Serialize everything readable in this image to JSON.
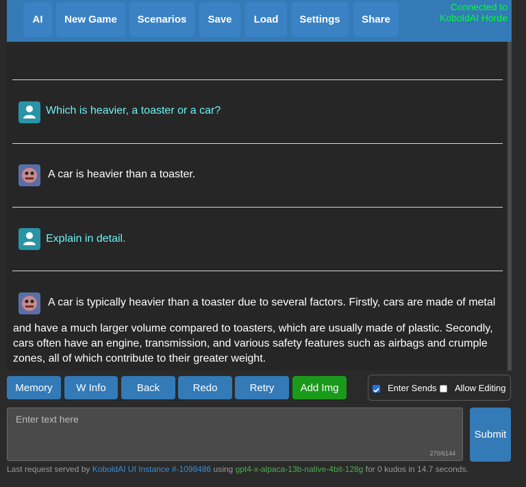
{
  "nav": {
    "buttons": [
      "AI",
      "New Game",
      "Scenarios",
      "Save",
      "Load",
      "Settings",
      "Share"
    ],
    "status_line1": "Connected to",
    "status_line2": "KoboldAI Horde"
  },
  "chat": {
    "messages": [
      {
        "role": "user",
        "text": "Which is heavier, a toaster or a car?"
      },
      {
        "role": "ai",
        "text": "A car is heavier than a toaster."
      },
      {
        "role": "user",
        "text": "Explain in detail."
      },
      {
        "role": "ai",
        "first_line": "A car is typically heavier than a toaster due to several factors. Firstly, cars are made of metal",
        "rest": "and have a much larger volume compared to toasters, which are usually made of plastic. Secondly, cars often have an engine, transmission, and various safety features such as airbags and crumple zones, all of which contribute to their greater weight."
      }
    ]
  },
  "actions": {
    "memory": "Memory",
    "winfo": "W Info",
    "back": "Back",
    "redo": "Redo",
    "retry": "Retry",
    "addimg": "Add Img"
  },
  "options": {
    "enter_sends": "Enter Sends",
    "enter_sends_checked": true,
    "allow_editing": "Allow Editing",
    "allow_editing_checked": false
  },
  "input": {
    "placeholder": "Enter text here",
    "counter": "270/6144"
  },
  "submit_label": "Submit",
  "footer": {
    "prefix": "Last request served by ",
    "instance": "KoboldAI UI Instance #-1098486",
    "using": " using ",
    "model": "gpt4-x-alpaca-13b-native-4bit-128g",
    "suffix": " for 0 kudos in 14.7 seconds."
  },
  "colors": {
    "accent": "#337ab7",
    "addimg": "#1a9a1a",
    "status": "#00ff33"
  }
}
